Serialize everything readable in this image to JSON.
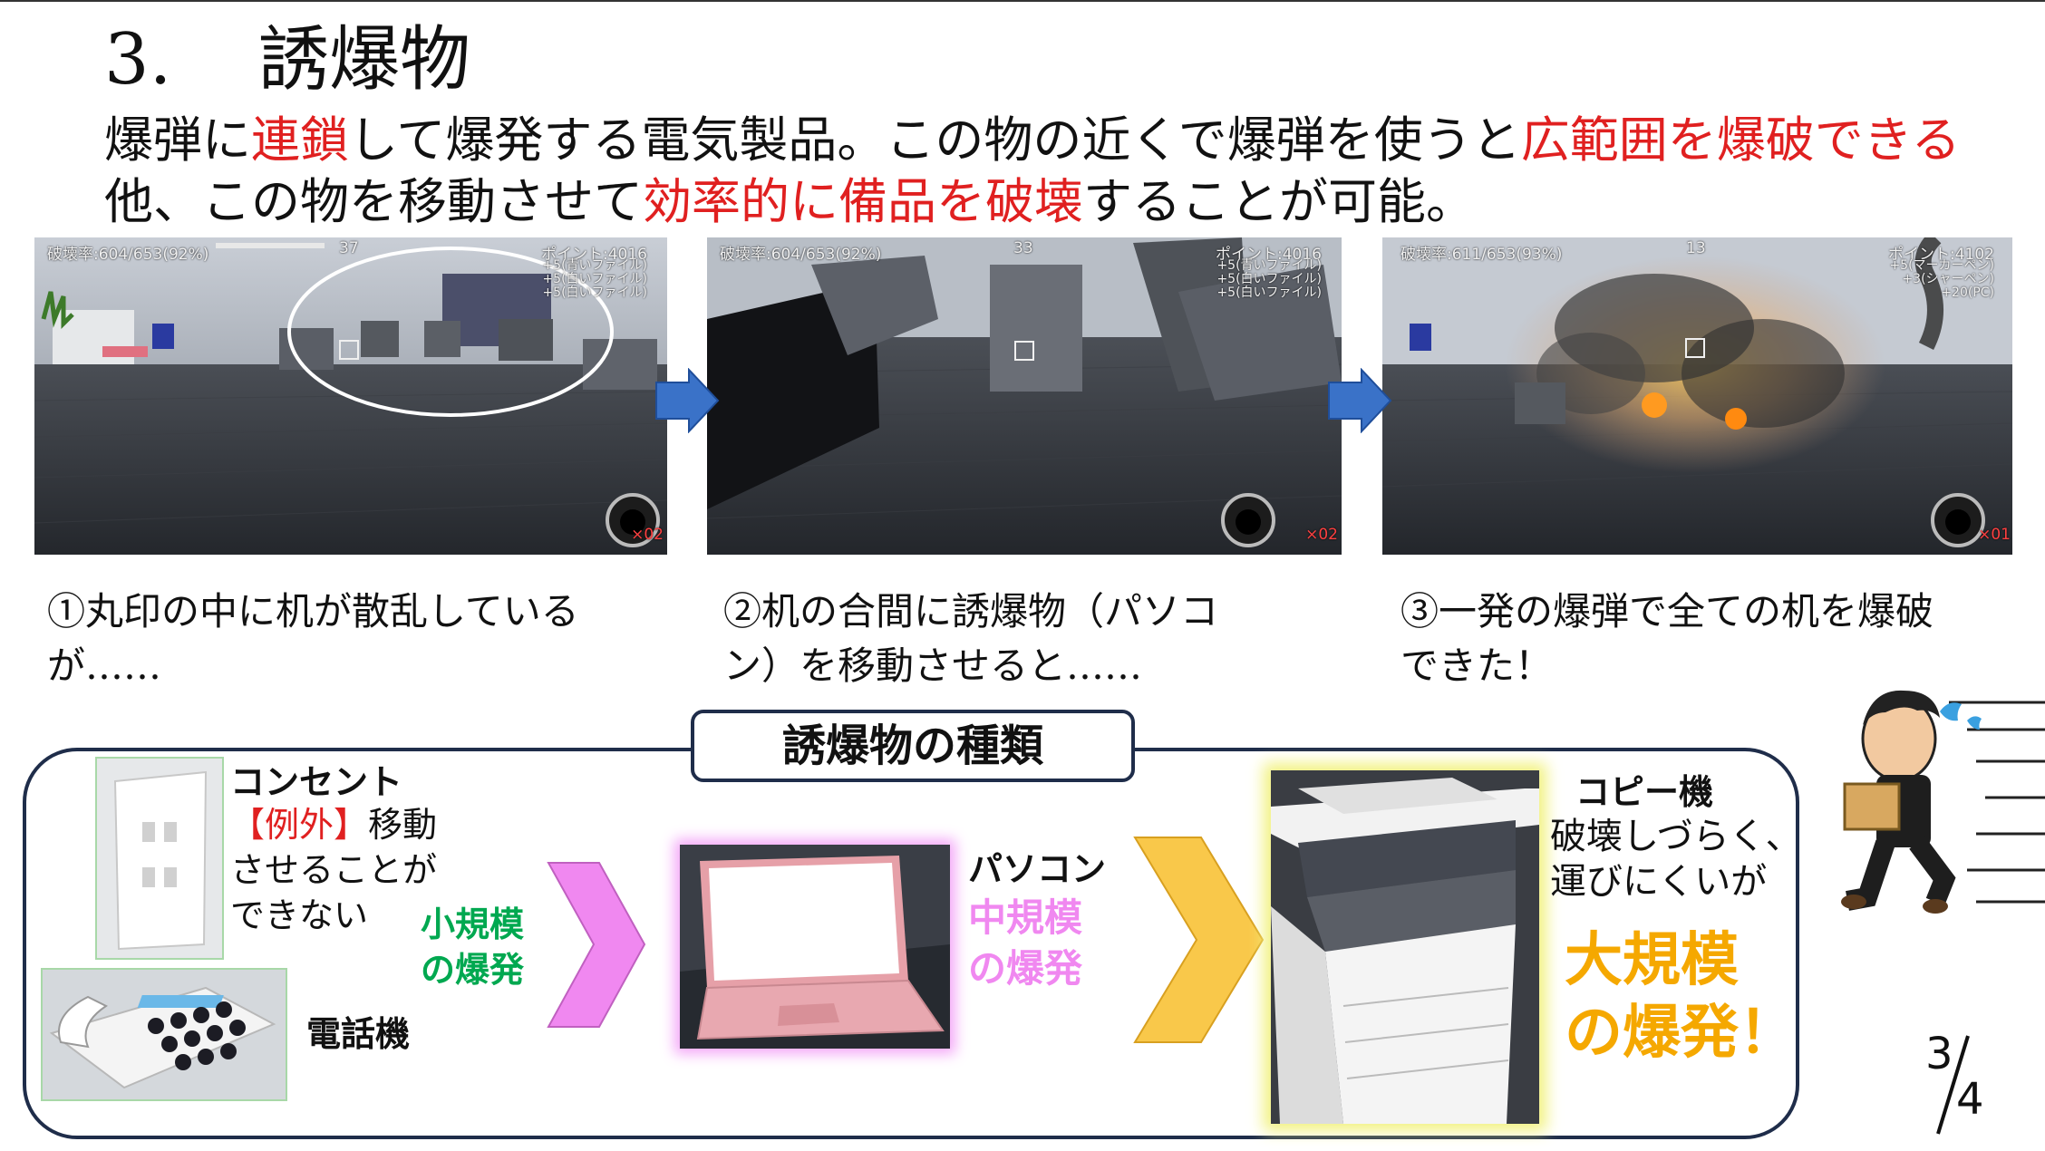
{
  "slide": {
    "title_num": "3.",
    "title": "誘爆物",
    "line1_a": "爆弾に",
    "line1_b": "連鎖",
    "line1_c": "して爆発する電気製品。この物の近くで爆弾を使うと",
    "line1_d": "広範囲を爆破できる",
    "line2_a": "他、この物を移動させて",
    "line2_b": "効率的に備品を破壊",
    "line2_c": "することが可能。"
  },
  "screens": [
    {
      "rate": "破壊率:604/653(92%)",
      "timer": "37",
      "points": "ポイント:4016",
      "log": [
        "+5(青いファイル)",
        "+5(白いファイル)",
        "+5(白いファイル)"
      ],
      "bombs": "×02"
    },
    {
      "rate": "破壊率:604/653(92%)",
      "timer": "33",
      "points": "ポイント:4016",
      "log": [
        "+5(青いファイル)",
        "+5(白いファイル)",
        "+5(白いファイル)"
      ],
      "bombs": "×02"
    },
    {
      "rate": "破壊率:611/653(93%)",
      "timer": "13",
      "points": "ポイント:4102",
      "log": [
        "+5(マーカーペン)",
        "+3(シャーペン)",
        "+20(PC)"
      ],
      "bombs": "×01"
    }
  ],
  "captions": [
    {
      "l1": "①丸印の中に机が散乱している",
      "l2": "が……"
    },
    {
      "l1": "②机の合間に誘爆物（パソコ",
      "l2": "ン）を移動させると……"
    },
    {
      "l1": "③一発の爆弾で全ての机を爆破",
      "l2": "できた！"
    }
  ],
  "types": {
    "heading": "誘爆物の種類",
    "outlet": "コンセント",
    "exception_tag": "【例外】",
    "exception_l1": "移動",
    "exception_l2": "させることが",
    "exception_l3": "できない",
    "phone": "電話機",
    "small_l1": "小規模",
    "small_l2": "の爆発",
    "pc": "パソコン",
    "mid_l1": "中規模",
    "mid_l2": "の爆発",
    "copier": "コピー機",
    "copier_l1": "破壊しづらく、",
    "copier_l2": "運びにくいが",
    "large_l1": "大規模",
    "large_l2": "の爆発！"
  },
  "page": {
    "current": "3",
    "total": "4"
  },
  "colors": {
    "accent_red": "#e02020",
    "small_green": "#00a850",
    "mid_pink": "#f088f0",
    "large_orange": "#f5a800",
    "frame_navy": "#1f2d4a",
    "arrow_blue": "#3a72c8"
  }
}
